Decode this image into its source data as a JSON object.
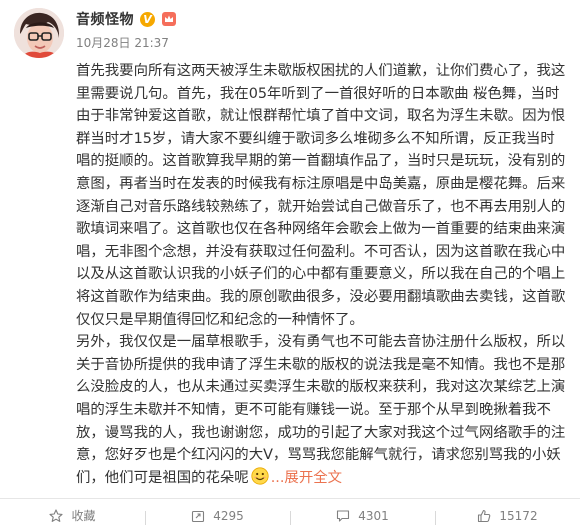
{
  "author": {
    "name": "音频怪物",
    "verified_badge": "V"
  },
  "post": {
    "timestamp": "10月28日 21:37",
    "paragraphs": [
      "首先我要向所有这两天被浮生未歇版权困扰的人们道歉，让你们费心了，我这里需要说几句。首先，我在05年听到了一首很好听的日本歌曲 桜色舞，当时由于非常钟爱这首歌，就让恨群帮忙填了首中文词，取名为浮生未歇。因为恨群当时才15岁，请大家不要纠缠于歌词多么堆砌多么不知所谓，反正我当时唱的挺顺的。这首歌算我早期的第一首翻填作品了，当时只是玩玩，没有别的意图，再者当时在发表的时候我有标注原唱是中岛美嘉，原曲是樱花舞。后来逐渐自己对音乐路线较熟练了，就开始尝试自己做音乐了，也不再去用别人的歌填词来唱了。这首歌也仅在各种网络年会歌会上做为一首重要的结束曲来演唱，无非图个念想，并没有获取过任何盈利。不可否认，因为这首歌在我心中以及从这首歌认识我的小妖子们的心中都有重要意义，所以我在自己的个唱上将这首歌作为结束曲。我的原创歌曲很多，没必要用翻填歌曲去卖钱，这首歌仅仅只是早期值得回忆和纪念的一种情怀了。",
      "另外，我仅仅是一届草根歌手，没有勇气也不可能去音协注册什么版权，所以关于音协所提供的我申请了浮生未歇的版权的说法我是毫不知情。我也不是那么没脸皮的人，也从未通过买卖浮生未歇的版权来获利，我对这次某综艺上演唱的浮生未歇并不知情，更不可能有赚钱一说。至于那个从早到晚揪着我不放，谩骂我的人，我也谢谢您，成功的引起了大家对我这个过气网络歌手的注意，您好歹也是个红闪闪的大V，骂骂我您能解气就行，请求您别骂我的小妖们，他们可是祖国的花朵呢"
    ],
    "expand_label": "...展开全文",
    "emoji_name": "smile-emoji"
  },
  "actions": [
    {
      "icon": "star-icon",
      "label": "收藏"
    },
    {
      "icon": "share-icon",
      "label": "4295"
    },
    {
      "icon": "comment-icon",
      "label": "4301"
    },
    {
      "icon": "like-icon",
      "label": "15172"
    }
  ],
  "colors": {
    "link": "#eb7350",
    "verified": "#f6a800",
    "text": "#333333",
    "muted": "#808080"
  }
}
